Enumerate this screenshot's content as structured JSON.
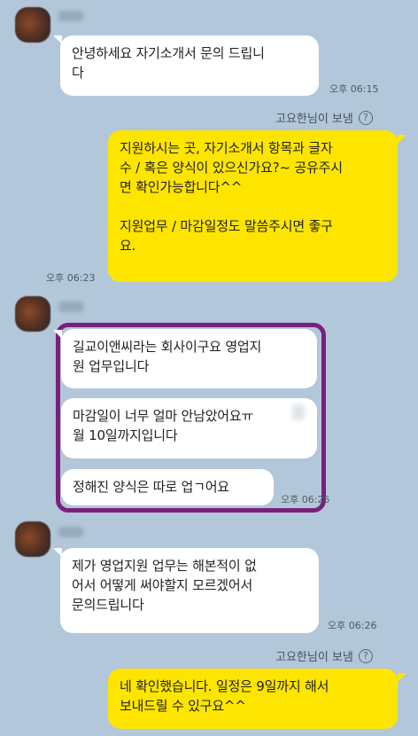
{
  "messages": {
    "m1": {
      "text": "안녕하세요 자기소개서 문의 드립니\n다",
      "time": "오후 06:15"
    },
    "read1": {
      "label": "고요한님이 보냄",
      "icon": "question-circle-icon"
    },
    "m2": {
      "text": "지원하시는 곳, 자기소개서 항목과 글자\n수 / 혹은 양식이 있으신가요?~ 공유주시\n면 확인가능합니다^^\n\n지원업무 / 마감일정도 말씀주시면 좋구\n요.",
      "time": "오후 06:23"
    },
    "m3": {
      "text": "길교이앤씨라는 회사이구요 영업지\n원 업무입니다"
    },
    "m4": {
      "text": "마감일이 너무 얼마 안남았어요ㅠ\n월 10일까지입니다"
    },
    "m5": {
      "text": "정해진 양식은 따로 업ㄱ어요",
      "time": "오후 06:25"
    },
    "m6": {
      "text": "제가 영업지원 업무는 해본적이 없\n어서 어떻게 써야할지 모르겠어서\n문의드립니다",
      "time": "오후 06:26"
    },
    "read2": {
      "label": "고요한님이 보냄",
      "icon": "question-circle-icon"
    },
    "m7": {
      "text": "네 확인했습니다. 일정은 9일까지 해서\n보내드릴 수 있구요^^"
    }
  },
  "colors": {
    "background": "#b2c7d9",
    "outgoing_bubble": "#fee500",
    "incoming_bubble": "#ffffff",
    "highlight_border": "#7b1f7e"
  }
}
